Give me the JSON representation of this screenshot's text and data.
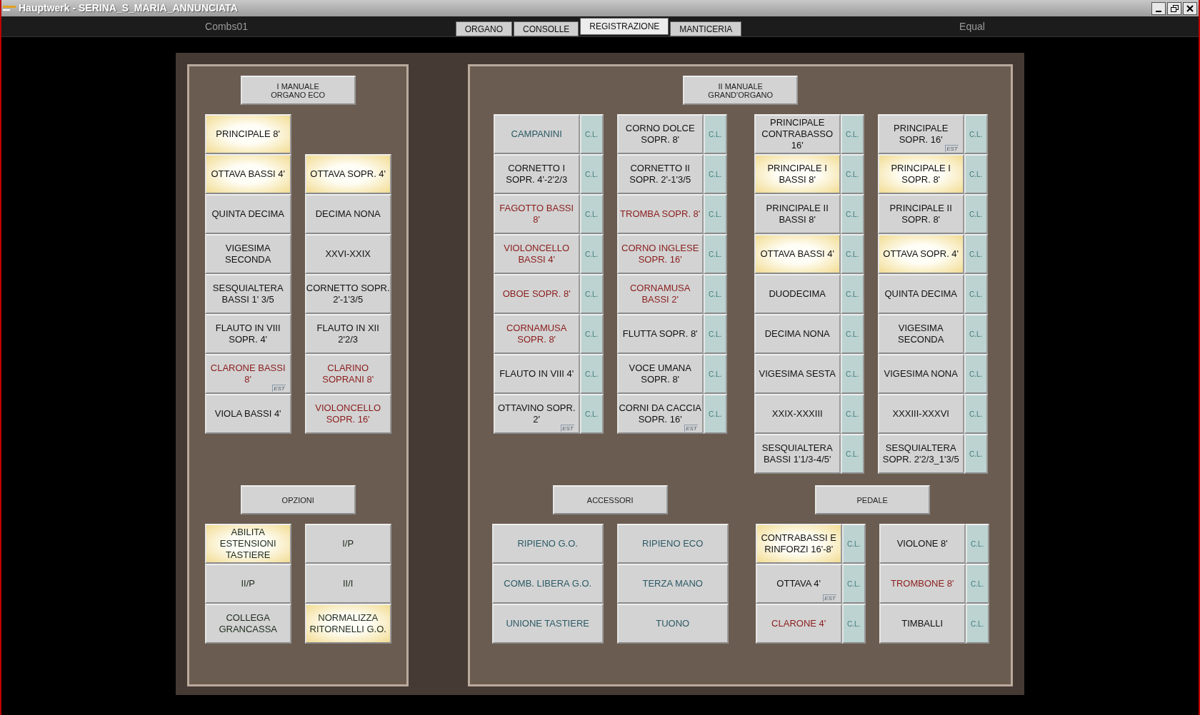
{
  "window": {
    "title": "Hauptwerk - SERINA_S_MARIA_ANNUNCIATA"
  },
  "toolbar": {
    "left": "Combs01",
    "right": "Equal",
    "tabs": [
      {
        "label": "ORGANO",
        "selected": false
      },
      {
        "label": "CONSOLLE",
        "selected": false
      },
      {
        "label": "REGISTRAZIONE",
        "selected": true
      },
      {
        "label": "MANTICERIA",
        "selected": false
      }
    ]
  },
  "panels": [
    {
      "upper": {
        "title_lines": [
          "I MANUALE",
          "ORGANO ECO"
        ],
        "columns": [
          [
            {
              "label": "PRINCIPALE 8'",
              "on": true,
              "color": "#111111"
            },
            {
              "label": "OTTAVA BASSI 4'",
              "on": true,
              "color": "#111111"
            },
            {
              "label": "QUINTA DECIMA",
              "on": false,
              "color": "#111111"
            },
            {
              "label": "VIGESIMA SECONDA",
              "on": false,
              "color": "#111111"
            },
            {
              "label": "SESQUIALTERA BASSI 1' 3/5",
              "on": false,
              "color": "#111111"
            },
            {
              "label": "FLAUTO IN VIII SOPR. 4'",
              "on": false,
              "color": "#111111"
            },
            {
              "label": "CLARONE BASSI 8'",
              "on": false,
              "color": "#8b1c1c",
              "badge": "EST"
            },
            {
              "label": "VIOLA BASSI 4'",
              "on": false,
              "color": "#111111"
            }
          ],
          [
            {
              "label": "OTTAVA SOPR. 4'",
              "on": true,
              "color": "#111111"
            },
            {
              "label": "DECIMA NONA",
              "on": false,
              "color": "#111111"
            },
            {
              "label": "XXVI-XXIX",
              "on": false,
              "color": "#111111"
            },
            {
              "label": "CORNETTO SOPR. 2'-1'3/5",
              "on": false,
              "color": "#111111"
            },
            {
              "label": "FLAUTO IN XII 2'2/3",
              "on": false,
              "color": "#111111"
            },
            {
              "label": "CLARINO SOPRANI 8'",
              "on": false,
              "color": "#8b1c1c"
            },
            {
              "label": "VIOLONCELLO SOPR. 16'",
              "on": false,
              "color": "#8b1c1c"
            }
          ]
        ]
      },
      "lower": [
        {
          "title_lines": [
            "OPZIONI"
          ],
          "columns": [
            [
              {
                "label": "ABILITA ESTENSIONI TASTIERE",
                "on": true,
                "color": "#1e2b1e"
              },
              {
                "label": "II/P",
                "on": false,
                "color": "#1e2b1e"
              },
              {
                "label": "COLLEGA GRANCASSA",
                "on": false,
                "color": "#1e2b1e"
              }
            ],
            [
              {
                "label": "I/P",
                "on": false,
                "color": "#1e2b1e"
              },
              {
                "label": "II/I",
                "on": false,
                "color": "#1e2b1e"
              },
              {
                "label": "NORMALIZZA RITORNELLI G.O.",
                "on": true,
                "color": "#1e2b1e"
              }
            ]
          ]
        }
      ]
    },
    {
      "upper": {
        "title_lines": [
          "II MANUALE",
          "GRAND'ORGANO"
        ],
        "columns": [
          [
            {
              "label": "CAMPANINI",
              "on": false,
              "color": "#2c5a66",
              "cl": "C.L."
            },
            {
              "label": "CORNETTO I SOPR. 4'-2'2/3",
              "on": false,
              "color": "#111111",
              "cl": "C.L."
            },
            {
              "label": "FAGOTTO BASSI 8'",
              "on": false,
              "color": "#8b1c1c",
              "cl": "C.L."
            },
            {
              "label": "VIOLONCELLO BASSI 4'",
              "on": false,
              "color": "#8b1c1c",
              "cl": "C.L."
            },
            {
              "label": "OBOE SOPR. 8'",
              "on": false,
              "color": "#8b1c1c",
              "cl": "C.L."
            },
            {
              "label": "CORNAMUSA SOPR. 8'",
              "on": false,
              "color": "#8b1c1c",
              "cl": "C.L."
            },
            {
              "label": "FLAUTO IN VIII 4'",
              "on": false,
              "color": "#111111",
              "cl": "C.L."
            },
            {
              "label": "OTTAVINO SOPR. 2'",
              "on": false,
              "color": "#111111",
              "cl": "C.L.",
              "badge": "EST"
            }
          ],
          [
            {
              "label": "CORNO DOLCE SOPR. 8'",
              "on": false,
              "color": "#111111",
              "cl": "C.L."
            },
            {
              "label": "CORNETTO II SOPR. 2'-1'3/5",
              "on": false,
              "color": "#111111",
              "cl": "C.L."
            },
            {
              "label": "TROMBA SOPR. 8'",
              "on": false,
              "color": "#8b1c1c",
              "cl": "C.L."
            },
            {
              "label": "CORNO INGLESE SOPR. 16'",
              "on": false,
              "color": "#8b1c1c",
              "cl": "C.L."
            },
            {
              "label": "CORNAMUSA BASSI 2'",
              "on": false,
              "color": "#8b1c1c",
              "cl": "C.L."
            },
            {
              "label": "FLUTTA SOPR. 8'",
              "on": false,
              "color": "#111111",
              "cl": "C.L."
            },
            {
              "label": "VOCE UMANA SOPR. 8'",
              "on": false,
              "color": "#111111",
              "cl": "C.L."
            },
            {
              "label": "CORNI DA CACCIA SOPR. 16'",
              "on": false,
              "color": "#111111",
              "cl": "C.L.",
              "badge": "EST"
            }
          ],
          [
            {
              "label": "PRINCIPALE CONTRABASSO 16'",
              "on": false,
              "color": "#111111",
              "cl": "C.L."
            },
            {
              "label": "PRINCIPALE I BASSI 8'",
              "on": true,
              "color": "#111111",
              "cl": "C.L."
            },
            {
              "label": "PRINCIPALE II BASSI 8'",
              "on": false,
              "color": "#111111",
              "cl": "C.L."
            },
            {
              "label": "OTTAVA BASSI 4'",
              "on": true,
              "color": "#111111",
              "cl": "C.L."
            },
            {
              "label": "DUODECIMA",
              "on": false,
              "color": "#111111",
              "cl": "C.L."
            },
            {
              "label": "DECIMA NONA",
              "on": false,
              "color": "#111111",
              "cl": "C.L."
            },
            {
              "label": "VIGESIMA SESTA",
              "on": false,
              "color": "#111111",
              "cl": "C.L."
            },
            {
              "label": "XXIX-XXXIII",
              "on": false,
              "color": "#111111",
              "cl": "C.L."
            },
            {
              "label": "SESQUIALTERA BASSI 1'1/3-4/5'",
              "on": false,
              "color": "#111111",
              "cl": "C.L."
            }
          ],
          [
            {
              "label": "PRINCIPALE SOPR. 16'",
              "on": false,
              "color": "#111111",
              "cl": "C.L.",
              "badge": "EST"
            },
            {
              "label": "PRINCIPALE I SOPR. 8'",
              "on": true,
              "color": "#111111",
              "cl": "C.L."
            },
            {
              "label": "PRINCIPALE II SOPR. 8'",
              "on": false,
              "color": "#111111",
              "cl": "C.L."
            },
            {
              "label": "OTTAVA SOPR. 4'",
              "on": true,
              "color": "#111111",
              "cl": "C.L."
            },
            {
              "label": "QUINTA DECIMA",
              "on": false,
              "color": "#111111",
              "cl": "C.L."
            },
            {
              "label": "VIGESIMA SECONDA",
              "on": false,
              "color": "#111111",
              "cl": "C.L."
            },
            {
              "label": "VIGESIMA NONA",
              "on": false,
              "color": "#111111",
              "cl": "C.L."
            },
            {
              "label": "XXXIII-XXXVI",
              "on": false,
              "color": "#111111",
              "cl": "C.L."
            },
            {
              "label": "SESQUIALTERA SOPR. 2'2/3_1'3/5",
              "on": false,
              "color": "#111111",
              "cl": "C.L."
            }
          ]
        ]
      },
      "lower": [
        {
          "title_lines": [
            "ACCESSORI"
          ],
          "columns": [
            [
              {
                "label": "RIPIENO G.O.",
                "on": false,
                "color": "#2c5a66"
              },
              {
                "label": "COMB. LIBERA G.O.",
                "on": false,
                "color": "#2c5a66"
              },
              {
                "label": "UNIONE TASTIERE",
                "on": false,
                "color": "#2c5a66"
              }
            ],
            [
              {
                "label": "RIPIENO ECO",
                "on": false,
                "color": "#2c5a66"
              },
              {
                "label": "TERZA MANO",
                "on": false,
                "color": "#2c5a66"
              },
              {
                "label": "TUONO",
                "on": false,
                "color": "#2c5a66"
              }
            ]
          ]
        },
        {
          "title_lines": [
            "PEDALE"
          ],
          "columns": [
            [
              {
                "label": "CONTRABASSI E RINFORZI 16'-8'",
                "on": true,
                "color": "#111111",
                "cl": "C.L."
              },
              {
                "label": "OTTAVA 4'",
                "on": false,
                "color": "#111111",
                "cl": "C.L.",
                "badge": "EST"
              },
              {
                "label": "CLARONE 4'",
                "on": false,
                "color": "#8b1c1c",
                "cl": "C.L."
              }
            ],
            [
              {
                "label": "VIOLONE 8'",
                "on": false,
                "color": "#111111",
                "cl": "C.L."
              },
              {
                "label": "TROMBONE 8'",
                "on": false,
                "color": "#8b1c1c",
                "cl": "C.L."
              },
              {
                "label": "TIMBALLI",
                "on": false,
                "color": "#111111",
                "cl": "C.L."
              }
            ]
          ]
        }
      ]
    }
  ]
}
